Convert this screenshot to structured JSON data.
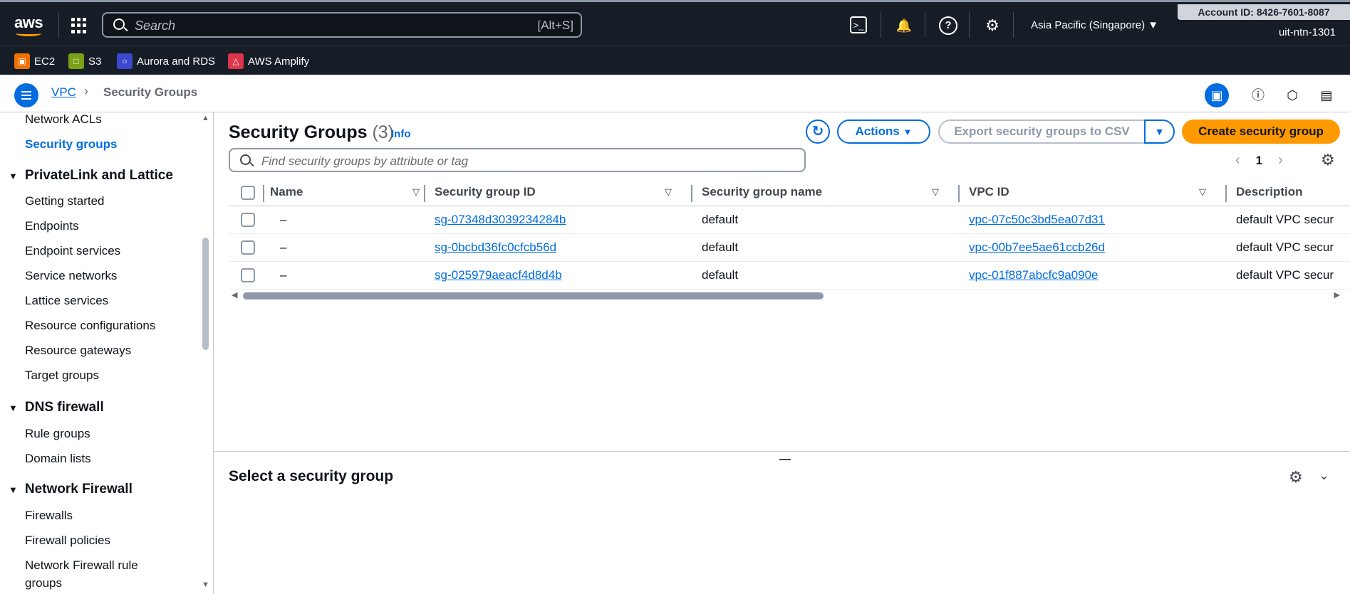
{
  "topbar": {
    "logo": "aws",
    "search_placeholder": "Search",
    "search_shortcut": "[Alt+S]",
    "region": "Asia Pacific (Singapore)",
    "account": "Account ID: 8426-7601-8087",
    "user": "uit-ntn-1301"
  },
  "favorites": [
    {
      "label": "EC2",
      "color": "#ed7100"
    },
    {
      "label": "S3",
      "color": "#7aa116"
    },
    {
      "label": "Aurora and RDS",
      "color": "#3b48cc"
    },
    {
      "label": "AWS Amplify",
      "color": "#dd344c"
    }
  ],
  "breadcrumb": {
    "service": "VPC",
    "current": "Security Groups"
  },
  "sidebar": {
    "items_top": [
      "Network ACLs",
      "Security groups"
    ],
    "sections": [
      {
        "title": "PrivateLink and Lattice",
        "items": [
          "Getting started",
          "Endpoints",
          "Endpoint services",
          "Service networks",
          "Lattice services",
          "Resource configurations",
          "Resource gateways",
          "Target groups"
        ]
      },
      {
        "title": "DNS firewall",
        "items": [
          "Rule groups",
          "Domain lists"
        ]
      },
      {
        "title": "Network Firewall",
        "items": [
          "Firewalls",
          "Firewall policies",
          "Network Firewall rule",
          "groups"
        ]
      }
    ]
  },
  "main": {
    "title": "Security Groups",
    "count": "(3)",
    "info": "Info",
    "actions_label": "Actions",
    "export_label": "Export security groups to CSV",
    "create_label": "Create security group",
    "filter_placeholder": "Find security groups by attribute or tag",
    "page": "1"
  },
  "table": {
    "columns": [
      "Name",
      "Security group ID",
      "Security group name",
      "VPC ID",
      "Description"
    ],
    "rows": [
      {
        "name": "–",
        "sg_id": "sg-07348d3039234284b",
        "sg_name": "default",
        "vpc_id": "vpc-07c50c3bd5ea07d31",
        "desc": "default VPC secur"
      },
      {
        "name": "–",
        "sg_id": "sg-0bcbd36fc0cfcb56d",
        "sg_name": "default",
        "vpc_id": "vpc-00b7ee5ae61ccb26d",
        "desc": "default VPC secur"
      },
      {
        "name": "–",
        "sg_id": "sg-025979aeacf4d8d4b",
        "sg_name": "default",
        "vpc_id": "vpc-01f887abcfc9a090e",
        "desc": "default VPC secur"
      }
    ]
  },
  "detail": {
    "title": "Select a security group"
  },
  "colors": {
    "accent": "#006ce0",
    "primary_button": "#ff9900",
    "topbar": "#161d26"
  }
}
